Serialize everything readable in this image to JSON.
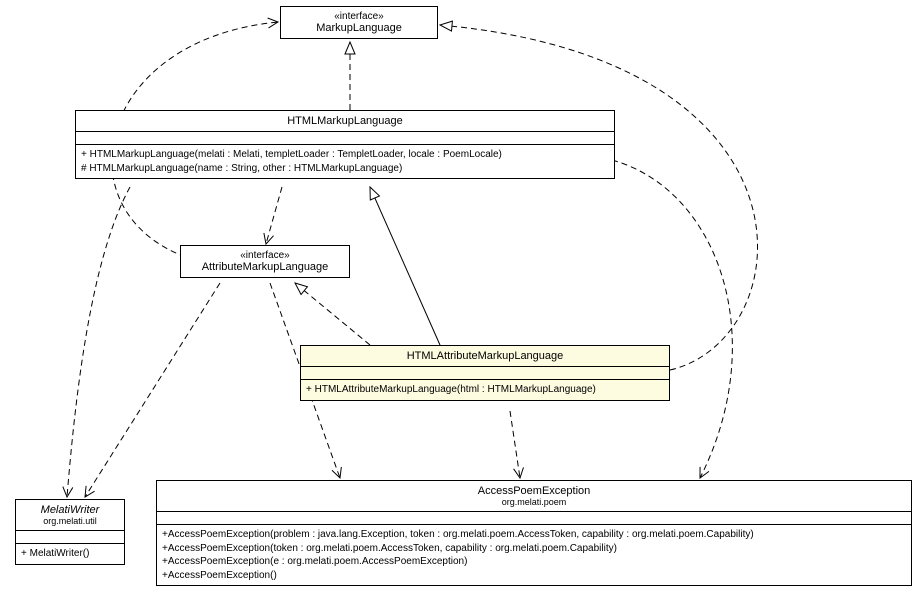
{
  "classes": {
    "markupLanguage": {
      "stereotype": "«interface»",
      "name": "MarkupLanguage"
    },
    "htmlMarkupLanguage": {
      "name": "HTMLMarkupLanguage",
      "ops": [
        "+ HTMLMarkupLanguage(melati : Melati, templetLoader : TempletLoader, locale : PoemLocale)",
        "# HTMLMarkupLanguage(name : String, other : HTMLMarkupLanguage)"
      ]
    },
    "attributeMarkupLanguage": {
      "stereotype": "«interface»",
      "name": "AttributeMarkupLanguage"
    },
    "htmlAttributeMarkupLanguage": {
      "name": "HTMLAttributeMarkupLanguage",
      "ops": [
        "+ HTMLAttributeMarkupLanguage(html : HTMLMarkupLanguage)"
      ]
    },
    "melatiWriter": {
      "name": "MelatiWriter",
      "package": "org.melati.util",
      "ops": [
        "+ MelatiWriter()"
      ]
    },
    "accessPoemException": {
      "name": "AccessPoemException",
      "package": "org.melati.poem",
      "ops": [
        "+AccessPoemException(problem : java.lang.Exception, token : org.melati.poem.AccessToken, capability : org.melati.poem.Capability)",
        "+AccessPoemException(token : org.melati.poem.AccessToken, capability : org.melati.poem.Capability)",
        "+AccessPoemException(e : org.melati.poem.AccessPoemException)",
        "+AccessPoemException()"
      ]
    }
  }
}
